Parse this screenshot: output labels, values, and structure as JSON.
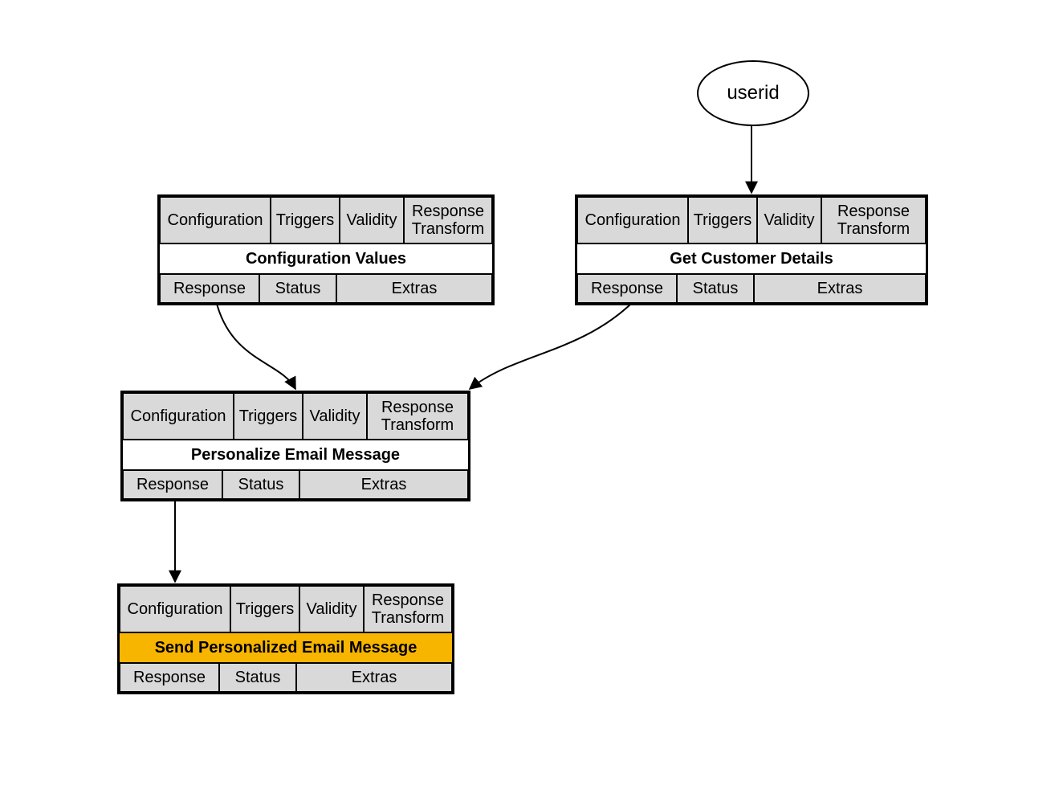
{
  "input_node": {
    "label": "userid"
  },
  "common": {
    "header_cells": {
      "configuration": "Configuration",
      "triggers": "Triggers",
      "validity": "Validity",
      "response_transform": "Response Transform"
    },
    "footer_cells": {
      "response": "Response",
      "status": "Status",
      "extras": "Extras"
    }
  },
  "nodes": {
    "config_values": {
      "title": "Configuration Values",
      "highlight": false
    },
    "get_customer": {
      "title": "Get Customer Details",
      "highlight": false
    },
    "personalize": {
      "title": "Personalize Email Message",
      "highlight": false
    },
    "send": {
      "title": "Send Personalized Email Message",
      "highlight": true
    }
  }
}
